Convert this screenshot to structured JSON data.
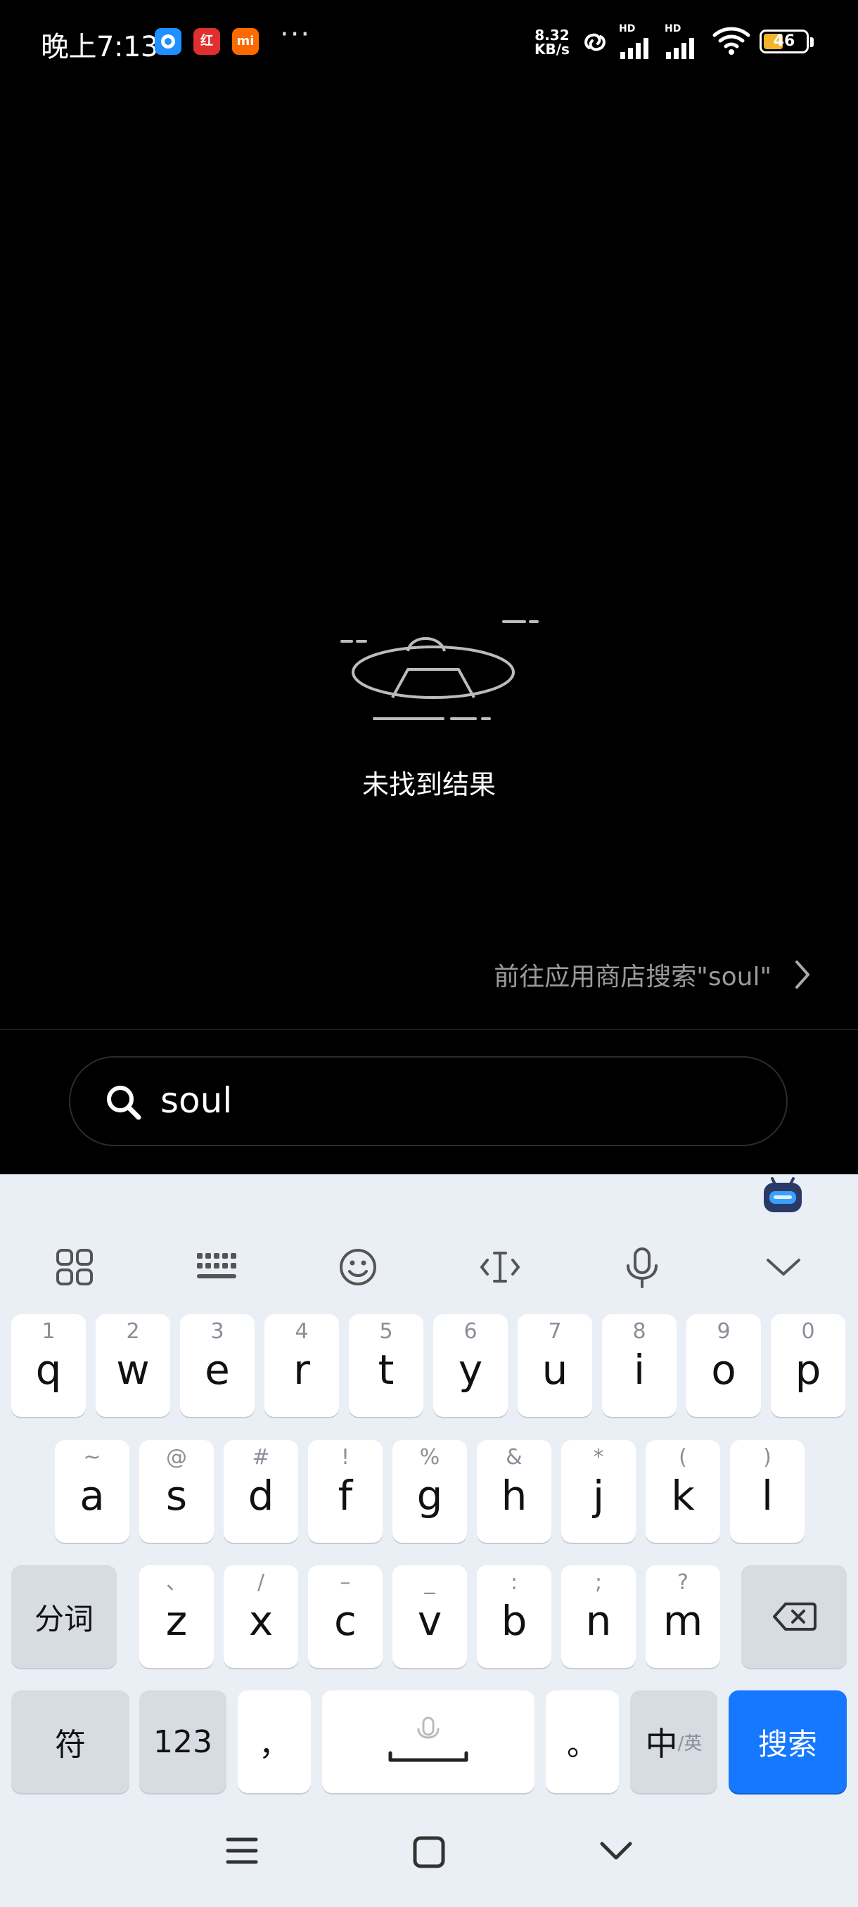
{
  "status_bar": {
    "time": "晚上7:13",
    "app_icons": [
      "blue-app-icon",
      "red-app-icon",
      "mi-app-icon"
    ],
    "mi_badge_text": "mi",
    "red_badge_text": "红",
    "more_indicator": "···",
    "net_speed_value": "8.32",
    "net_speed_unit": "KB/s",
    "signal_1_label": "HD",
    "signal_2_label": "HD",
    "battery_level": "46",
    "battery_fraction": 0.46
  },
  "empty_state": {
    "icon": "ufo-icon",
    "message": "未找到结果"
  },
  "store_link": {
    "label": "前往应用商店搜索\"soul\""
  },
  "search": {
    "value": "soul"
  },
  "keyboard": {
    "toolbar": [
      "grid-icon",
      "keyboard-icon",
      "emoji-icon",
      "cursor-icon",
      "mic-icon",
      "collapse-icon"
    ],
    "row1": [
      {
        "hint": "1",
        "key": "q"
      },
      {
        "hint": "2",
        "key": "w"
      },
      {
        "hint": "3",
        "key": "e"
      },
      {
        "hint": "4",
        "key": "r"
      },
      {
        "hint": "5",
        "key": "t"
      },
      {
        "hint": "6",
        "key": "y"
      },
      {
        "hint": "7",
        "key": "u"
      },
      {
        "hint": "8",
        "key": "i"
      },
      {
        "hint": "9",
        "key": "o"
      },
      {
        "hint": "0",
        "key": "p"
      }
    ],
    "row2": [
      {
        "hint": "~",
        "key": "a"
      },
      {
        "hint": "@",
        "key": "s"
      },
      {
        "hint": "#",
        "key": "d"
      },
      {
        "hint": "!",
        "key": "f"
      },
      {
        "hint": "%",
        "key": "g"
      },
      {
        "hint": "&",
        "key": "h"
      },
      {
        "hint": "*",
        "key": "j"
      },
      {
        "hint": "(",
        "key": "k"
      },
      {
        "hint": ")",
        "key": "l"
      }
    ],
    "row3_left": "分词",
    "row3": [
      {
        "hint": "、",
        "key": "z"
      },
      {
        "hint": "/",
        "key": "x"
      },
      {
        "hint": "–",
        "key": "c"
      },
      {
        "hint": "_",
        "key": "v"
      },
      {
        "hint": ":",
        "key": "b"
      },
      {
        "hint": ";",
        "key": "n"
      },
      {
        "hint": "?",
        "key": "m"
      }
    ],
    "row4": {
      "symbols": "符",
      "numbers": "123",
      "comma": "，",
      "period": "。",
      "lang_main": "中",
      "lang_alt": "/英",
      "search": "搜索"
    }
  },
  "colors": {
    "accent": "#1677ff",
    "battery": "#f2b52e",
    "keyboard_bg": "#eaeef5"
  }
}
